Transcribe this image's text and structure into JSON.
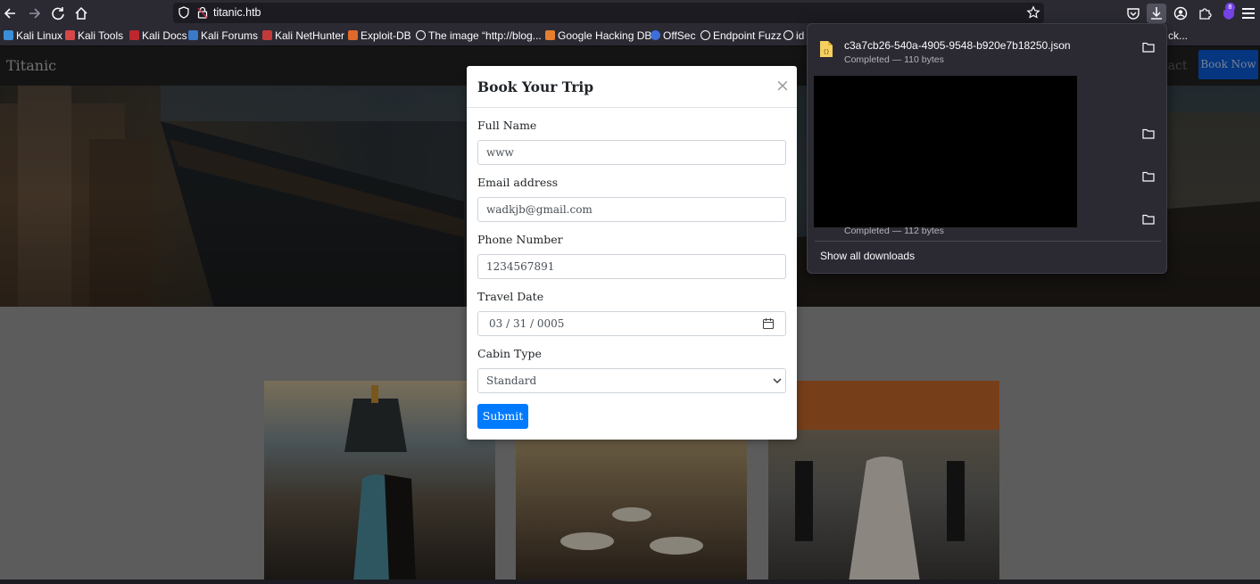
{
  "browser": {
    "url": "titanic.htb",
    "extensions_badge": "8",
    "bookmarks": [
      {
        "label": "Kali Linux",
        "icon": "kali-dragon-icon"
      },
      {
        "label": "Kali Tools",
        "icon": "kali-tools-icon"
      },
      {
        "label": "Kali Docs",
        "icon": "kali-docs-icon"
      },
      {
        "label": "Kali Forums",
        "icon": "kali-forums-icon"
      },
      {
        "label": "Kali NetHunter",
        "icon": "nethunter-icon"
      },
      {
        "label": "Exploit-DB",
        "icon": "exploit-db-icon"
      },
      {
        "label": "The image “http://blog...",
        "icon": "globe-icon"
      },
      {
        "label": "Google Hacking DB",
        "icon": "ghdb-icon"
      },
      {
        "label": "OffSec",
        "icon": "offsec-icon"
      },
      {
        "label": "Endpoint Fuzz",
        "icon": "globe-icon"
      },
      {
        "label": "id",
        "icon": "globe-icon"
      },
      {
        "label": "ck...",
        "icon": "none"
      }
    ]
  },
  "site": {
    "brand": "Titanic",
    "nav_link_partial": "ntact",
    "book_now": "Book Now"
  },
  "modal": {
    "title": "Book Your Trip",
    "close": "×",
    "fields": {
      "full_name": {
        "label": "Full Name",
        "value": "www"
      },
      "email": {
        "label": "Email address",
        "value": "wadkjb@gmail.com"
      },
      "phone": {
        "label": "Phone Number",
        "value": "1234567891"
      },
      "travel_date": {
        "label": "Travel Date",
        "value": "03 / 31 / 0005"
      },
      "cabin": {
        "label": "Cabin Type",
        "value": "Standard"
      }
    },
    "submit": "Submit"
  },
  "downloads": {
    "items": [
      {
        "name": "c3a7cb26-540a-4905-9548-b920e7b18250.json",
        "status": "Completed — 110 bytes"
      },
      {
        "name": "",
        "status": ""
      },
      {
        "name": "",
        "status": ""
      },
      {
        "name": "",
        "status": "Completed — 112 bytes"
      }
    ],
    "show_all": "Show all downloads"
  },
  "colors": {
    "chrome_bg": "#2b2a33",
    "chrome_dark": "#1c1b22",
    "primary_button": "#007bff",
    "book_now_bg": "#0a5ad6"
  }
}
